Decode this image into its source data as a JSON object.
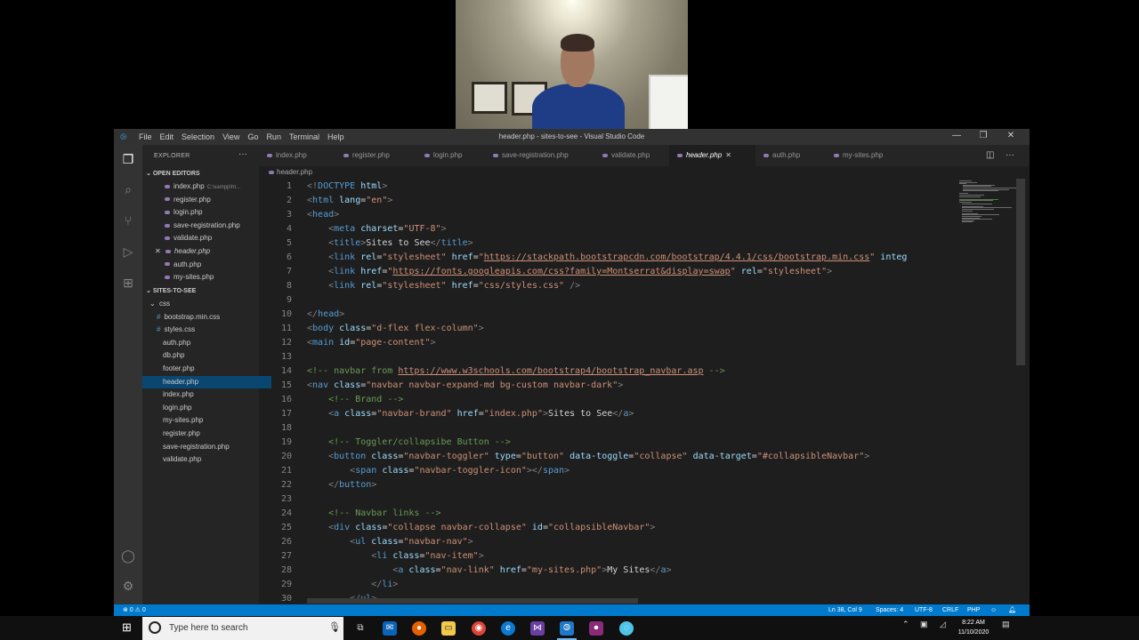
{
  "window": {
    "title": "header.php - sites-to-see - Visual Studio Code",
    "menu": [
      "File",
      "Edit",
      "Selection",
      "View",
      "Go",
      "Run",
      "Terminal",
      "Help"
    ]
  },
  "sidebar": {
    "title": "EXPLORER",
    "open_editors_label": "OPEN EDITORS",
    "open_editors": [
      {
        "name": "index.php",
        "path": "C:\\xampp\\ht..."
      },
      {
        "name": "register.php"
      },
      {
        "name": "login.php"
      },
      {
        "name": "save-registration.php"
      },
      {
        "name": "validate.php"
      },
      {
        "name": "header.php"
      },
      {
        "name": "auth.php"
      },
      {
        "name": "my-sites.php"
      }
    ],
    "project_label": "SITES-TO-SEE",
    "tree": [
      {
        "name": "css",
        "type": "folder"
      },
      {
        "name": "bootstrap.min.css",
        "type": "css"
      },
      {
        "name": "styles.css",
        "type": "css"
      },
      {
        "name": "auth.php",
        "type": "php"
      },
      {
        "name": "db.php",
        "type": "php"
      },
      {
        "name": "footer.php",
        "type": "php"
      },
      {
        "name": "header.php",
        "type": "php"
      },
      {
        "name": "index.php",
        "type": "php"
      },
      {
        "name": "login.php",
        "type": "php"
      },
      {
        "name": "my-sites.php",
        "type": "php"
      },
      {
        "name": "register.php",
        "type": "php"
      },
      {
        "name": "save-registration.php",
        "type": "php"
      },
      {
        "name": "validate.php",
        "type": "php"
      }
    ]
  },
  "tabs": [
    "index.php",
    "register.php",
    "login.php",
    "save-registration.php",
    "validate.php",
    "header.php",
    "auth.php",
    "my-sites.php"
  ],
  "active_tab": "header.php",
  "breadcrumb": "header.php",
  "code_lines": [
    {
      "n": "1",
      "segs": [
        [
          "p",
          "<!"
        ],
        [
          "tag",
          "DOCTYPE"
        ],
        [
          "attr",
          " html"
        ],
        [
          "p",
          ">"
        ]
      ]
    },
    {
      "n": "2",
      "segs": [
        [
          "p",
          "<"
        ],
        [
          "tag",
          "html"
        ],
        [
          "attr",
          " lang"
        ],
        [
          "txt",
          "="
        ],
        [
          "str",
          "\"en\""
        ],
        [
          "p",
          ">"
        ]
      ]
    },
    {
      "n": "3",
      "segs": [
        [
          "p",
          "<"
        ],
        [
          "tag",
          "head"
        ],
        [
          "p",
          ">"
        ]
      ]
    },
    {
      "n": "4",
      "segs": [
        [
          "txt",
          "    "
        ],
        [
          "p",
          "<"
        ],
        [
          "tag",
          "meta"
        ],
        [
          "attr",
          " charset"
        ],
        [
          "txt",
          "="
        ],
        [
          "str",
          "\"UTF-8\""
        ],
        [
          "p",
          ">"
        ]
      ]
    },
    {
      "n": "5",
      "segs": [
        [
          "txt",
          "    "
        ],
        [
          "p",
          "<"
        ],
        [
          "tag",
          "title"
        ],
        [
          "p",
          ">"
        ],
        [
          "txt",
          "Sites to See"
        ],
        [
          "p",
          "</"
        ],
        [
          "tag",
          "title"
        ],
        [
          "p",
          ">"
        ]
      ]
    },
    {
      "n": "6",
      "segs": [
        [
          "txt",
          "    "
        ],
        [
          "p",
          "<"
        ],
        [
          "tag",
          "link"
        ],
        [
          "attr",
          " rel"
        ],
        [
          "txt",
          "="
        ],
        [
          "str",
          "\"stylesheet\""
        ],
        [
          "attr",
          " href"
        ],
        [
          "txt",
          "="
        ],
        [
          "str",
          "\""
        ],
        [
          "url",
          "https://stackpath.bootstrapcdn.com/bootstrap/4.4.1/css/bootstrap.min.css"
        ],
        [
          "str",
          "\""
        ],
        [
          "attr",
          " integ"
        ]
      ]
    },
    {
      "n": "7",
      "segs": [
        [
          "txt",
          "    "
        ],
        [
          "p",
          "<"
        ],
        [
          "tag",
          "link"
        ],
        [
          "attr",
          " href"
        ],
        [
          "txt",
          "="
        ],
        [
          "str",
          "\""
        ],
        [
          "url",
          "https://fonts.googleapis.com/css?family=Montserrat&display=swap"
        ],
        [
          "str",
          "\""
        ],
        [
          "attr",
          " rel"
        ],
        [
          "txt",
          "="
        ],
        [
          "str",
          "\"stylesheet\""
        ],
        [
          "p",
          ">"
        ]
      ]
    },
    {
      "n": "8",
      "segs": [
        [
          "txt",
          "    "
        ],
        [
          "p",
          "<"
        ],
        [
          "tag",
          "link"
        ],
        [
          "attr",
          " rel"
        ],
        [
          "txt",
          "="
        ],
        [
          "str",
          "\"stylesheet\""
        ],
        [
          "attr",
          " href"
        ],
        [
          "txt",
          "="
        ],
        [
          "str",
          "\"css/styles.css\""
        ],
        [
          "p",
          " />"
        ]
      ]
    },
    {
      "n": "9",
      "segs": []
    },
    {
      "n": "10",
      "segs": [
        [
          "p",
          "</"
        ],
        [
          "tag",
          "head"
        ],
        [
          "p",
          ">"
        ]
      ]
    },
    {
      "n": "11",
      "segs": [
        [
          "p",
          "<"
        ],
        [
          "tag",
          "body"
        ],
        [
          "attr",
          " class"
        ],
        [
          "txt",
          "="
        ],
        [
          "str",
          "\"d-flex flex-column\""
        ],
        [
          "p",
          ">"
        ]
      ]
    },
    {
      "n": "12",
      "segs": [
        [
          "p",
          "<"
        ],
        [
          "tag",
          "main"
        ],
        [
          "attr",
          " id"
        ],
        [
          "txt",
          "="
        ],
        [
          "str",
          "\"page-content\""
        ],
        [
          "p",
          ">"
        ]
      ]
    },
    {
      "n": "13",
      "segs": []
    },
    {
      "n": "14",
      "segs": [
        [
          "com",
          "<!-- navbar from "
        ],
        [
          "url",
          "https://www.w3schools.com/bootstrap4/bootstrap_navbar.asp"
        ],
        [
          "com",
          " -->"
        ]
      ]
    },
    {
      "n": "15",
      "segs": [
        [
          "p",
          "<"
        ],
        [
          "tag",
          "nav"
        ],
        [
          "attr",
          " class"
        ],
        [
          "txt",
          "="
        ],
        [
          "str",
          "\"navbar navbar-expand-md bg-custom navbar-dark\""
        ],
        [
          "p",
          ">"
        ]
      ]
    },
    {
      "n": "16",
      "segs": [
        [
          "txt",
          "    "
        ],
        [
          "com",
          "<!-- Brand -->"
        ]
      ]
    },
    {
      "n": "17",
      "segs": [
        [
          "txt",
          "    "
        ],
        [
          "p",
          "<"
        ],
        [
          "tag",
          "a"
        ],
        [
          "attr",
          " class"
        ],
        [
          "txt",
          "="
        ],
        [
          "str",
          "\"navbar-brand\""
        ],
        [
          "attr",
          " href"
        ],
        [
          "txt",
          "="
        ],
        [
          "str",
          "\"index.php\""
        ],
        [
          "p",
          ">"
        ],
        [
          "txt",
          "Sites to See"
        ],
        [
          "p",
          "</"
        ],
        [
          "tag",
          "a"
        ],
        [
          "p",
          ">"
        ]
      ]
    },
    {
      "n": "18",
      "segs": []
    },
    {
      "n": "19",
      "segs": [
        [
          "txt",
          "    "
        ],
        [
          "com",
          "<!-- Toggler/collapsibe Button -->"
        ]
      ]
    },
    {
      "n": "20",
      "segs": [
        [
          "txt",
          "    "
        ],
        [
          "p",
          "<"
        ],
        [
          "tag",
          "button"
        ],
        [
          "attr",
          " class"
        ],
        [
          "txt",
          "="
        ],
        [
          "str",
          "\"navbar-toggler\""
        ],
        [
          "attr",
          " type"
        ],
        [
          "txt",
          "="
        ],
        [
          "str",
          "\"button\""
        ],
        [
          "attr",
          " data-toggle"
        ],
        [
          "txt",
          "="
        ],
        [
          "str",
          "\"collapse\""
        ],
        [
          "attr",
          " data-target"
        ],
        [
          "txt",
          "="
        ],
        [
          "str",
          "\"#collapsibleNavbar\""
        ],
        [
          "p",
          ">"
        ]
      ]
    },
    {
      "n": "21",
      "segs": [
        [
          "txt",
          "        "
        ],
        [
          "p",
          "<"
        ],
        [
          "tag",
          "span"
        ],
        [
          "attr",
          " class"
        ],
        [
          "txt",
          "="
        ],
        [
          "str",
          "\"navbar-toggler-icon\""
        ],
        [
          "p",
          "></"
        ],
        [
          "tag",
          "span"
        ],
        [
          "p",
          ">"
        ]
      ]
    },
    {
      "n": "22",
      "segs": [
        [
          "txt",
          "    "
        ],
        [
          "p",
          "</"
        ],
        [
          "tag",
          "button"
        ],
        [
          "p",
          ">"
        ]
      ]
    },
    {
      "n": "23",
      "segs": []
    },
    {
      "n": "24",
      "segs": [
        [
          "txt",
          "    "
        ],
        [
          "com",
          "<!-- Navbar links -->"
        ]
      ]
    },
    {
      "n": "25",
      "segs": [
        [
          "txt",
          "    "
        ],
        [
          "p",
          "<"
        ],
        [
          "tag",
          "div"
        ],
        [
          "attr",
          " class"
        ],
        [
          "txt",
          "="
        ],
        [
          "str",
          "\"collapse navbar-collapse\""
        ],
        [
          "attr",
          " id"
        ],
        [
          "txt",
          "="
        ],
        [
          "str",
          "\"collapsibleNavbar\""
        ],
        [
          "p",
          ">"
        ]
      ]
    },
    {
      "n": "26",
      "segs": [
        [
          "txt",
          "        "
        ],
        [
          "p",
          "<"
        ],
        [
          "tag",
          "ul"
        ],
        [
          "attr",
          " class"
        ],
        [
          "txt",
          "="
        ],
        [
          "str",
          "\"navbar-nav\""
        ],
        [
          "p",
          ">"
        ]
      ]
    },
    {
      "n": "27",
      "segs": [
        [
          "txt",
          "            "
        ],
        [
          "p",
          "<"
        ],
        [
          "tag",
          "li"
        ],
        [
          "attr",
          " class"
        ],
        [
          "txt",
          "="
        ],
        [
          "str",
          "\"nav-item\""
        ],
        [
          "p",
          ">"
        ]
      ]
    },
    {
      "n": "28",
      "segs": [
        [
          "txt",
          "                "
        ],
        [
          "p",
          "<"
        ],
        [
          "tag",
          "a"
        ],
        [
          "attr",
          " class"
        ],
        [
          "txt",
          "="
        ],
        [
          "str",
          "\"nav-link\""
        ],
        [
          "attr",
          " href"
        ],
        [
          "txt",
          "="
        ],
        [
          "str",
          "\"my-sites.php\""
        ],
        [
          "p",
          ">"
        ],
        [
          "txt",
          "My Sites"
        ],
        [
          "p",
          "</"
        ],
        [
          "tag",
          "a"
        ],
        [
          "p",
          ">"
        ]
      ]
    },
    {
      "n": "29",
      "segs": [
        [
          "txt",
          "            "
        ],
        [
          "p",
          "</"
        ],
        [
          "tag",
          "li"
        ],
        [
          "p",
          ">"
        ]
      ]
    },
    {
      "n": "30",
      "segs": [
        [
          "txt",
          "        "
        ],
        [
          "p",
          "</"
        ],
        [
          "tag",
          "ul"
        ],
        [
          "p",
          ">"
        ]
      ]
    }
  ],
  "status": {
    "problems": "0",
    "warnings": "0",
    "position": "Ln 38, Col 9",
    "spaces": "Spaces: 4",
    "encoding": "UTF-8",
    "eol": "CRLF",
    "language": "PHP"
  },
  "taskbar": {
    "search_placeholder": "Type here to search",
    "time": "8:22 AM",
    "date": "11/10/2020"
  },
  "colors": {
    "statusbar": "#007acc",
    "selection": "#094771",
    "editor_bg": "#1e1e1e"
  }
}
